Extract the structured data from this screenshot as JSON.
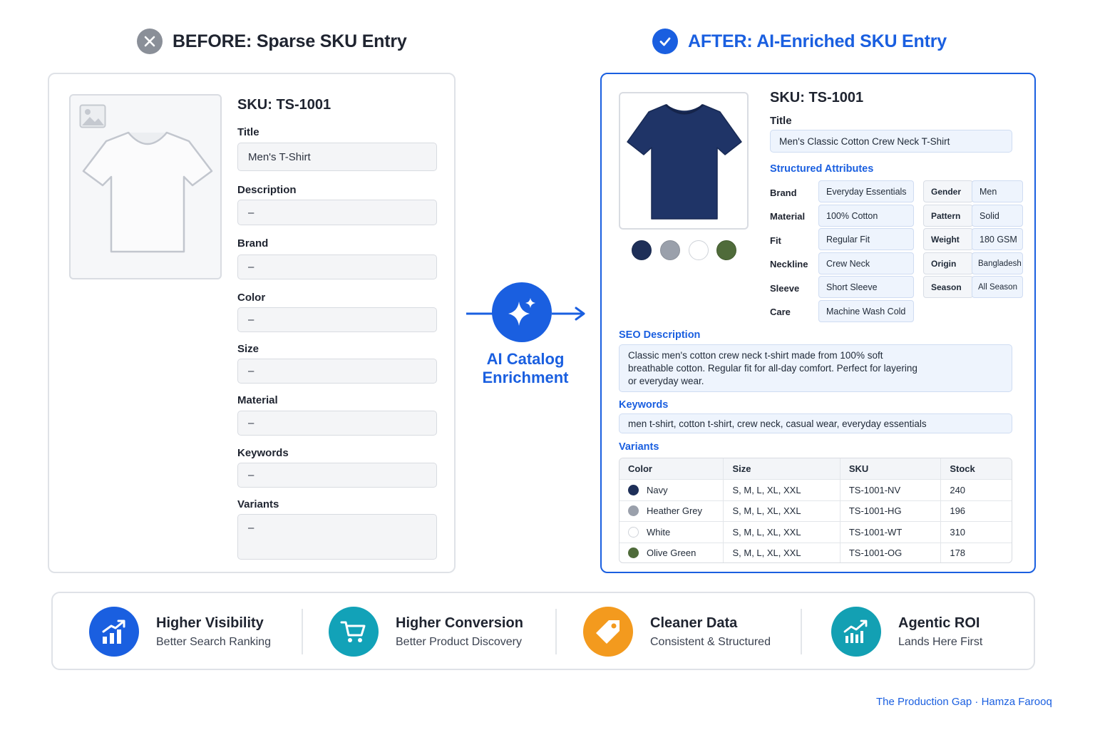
{
  "before": {
    "heading": "BEFORE: Sparse SKU Entry",
    "sku": "SKU: TS-1001",
    "fields": [
      {
        "label": "Title",
        "value": "Men's T-Shirt"
      },
      {
        "label": "Description",
        "value": "–"
      },
      {
        "label": "Brand",
        "value": "–"
      },
      {
        "label": "Color",
        "value": "–"
      },
      {
        "label": "Size",
        "value": "–"
      },
      {
        "label": "Material",
        "value": "–"
      },
      {
        "label": "Keywords",
        "value": "–"
      },
      {
        "label": "Variants",
        "value": "–"
      }
    ]
  },
  "center": {
    "line1": "AI Catalog",
    "line2": "Enrichment"
  },
  "after": {
    "heading": "AFTER: AI-Enriched SKU Entry",
    "sku": "SKU: TS-1001",
    "title_label": "Title",
    "title_value": "Men's Classic Cotton Crew Neck T-Shirt",
    "attributes_heading": "Structured Attributes",
    "attributes_left": [
      {
        "label": "Brand",
        "value": "Everyday Essentials"
      },
      {
        "label": "Material",
        "value": "100% Cotton"
      },
      {
        "label": "Fit",
        "value": "Regular Fit"
      },
      {
        "label": "Neckline",
        "value": "Crew Neck"
      },
      {
        "label": "Sleeve",
        "value": "Short Sleeve"
      },
      {
        "label": "Care",
        "value": "Machine Wash Cold"
      }
    ],
    "attributes_right": [
      {
        "label": "Gender",
        "value": "Men"
      },
      {
        "label": "Pattern",
        "value": "Solid"
      },
      {
        "label": "Weight",
        "value": "180 GSM"
      },
      {
        "label": "Origin",
        "value": "Bangladesh"
      },
      {
        "label": "Season",
        "value": "All Season"
      }
    ],
    "swatches": [
      "#1e2f58",
      "#9aa0ab",
      "#ffffff",
      "#4f6b3a"
    ],
    "seo_heading": "SEO Description",
    "seo_lines": [
      "Classic men's cotton crew neck t-shirt made from 100% soft",
      "breathable cotton. Regular fit for all-day comfort. Perfect for layering",
      "or everyday wear."
    ],
    "keywords_heading": "Keywords",
    "keywords_value": "men t-shirt, cotton t-shirt, crew neck, casual wear, everyday essentials",
    "variants_heading": "Variants",
    "variants_columns": [
      "Color",
      "Size",
      "SKU",
      "Stock"
    ],
    "variants_rows": [
      {
        "color": "Navy",
        "dot": "#1e2f58",
        "size": "S, M, L, XL, XXL",
        "sku": "TS-1001-NV",
        "stock": "240"
      },
      {
        "color": "Heather Grey",
        "dot": "#9aa0ab",
        "size": "S, M, L, XL, XXL",
        "sku": "TS-1001-HG",
        "stock": "196"
      },
      {
        "color": "White",
        "dot": "#ffffff",
        "size": "S, M, L, XL, XXL",
        "sku": "TS-1001-WT",
        "stock": "310"
      },
      {
        "color": "Olive Green",
        "dot": "#4f6b3a",
        "size": "S, M, L, XL, XXL",
        "sku": "TS-1001-OG",
        "stock": "178"
      }
    ]
  },
  "benefits": [
    {
      "title": "Higher Visibility",
      "sub": "Better Search Ranking",
      "icon": "bar-chart-up-icon",
      "color": "#1a5fe0"
    },
    {
      "title": "Higher Conversion",
      "sub": "Better Product Discovery",
      "icon": "shopping-cart-icon",
      "color": "#12a2b8"
    },
    {
      "title": "Cleaner Data",
      "sub": "Consistent & Structured",
      "icon": "tag-icon",
      "color": "#f39a1e"
    },
    {
      "title": "Agentic ROI",
      "sub": "Lands Here First",
      "icon": "growth-chart-icon",
      "color": "#13a0b3"
    }
  ],
  "footer": "The Production Gap · Hamza Farooq",
  "colors": {
    "accent": "#1a5fe0",
    "muted": "#8a8f98"
  }
}
